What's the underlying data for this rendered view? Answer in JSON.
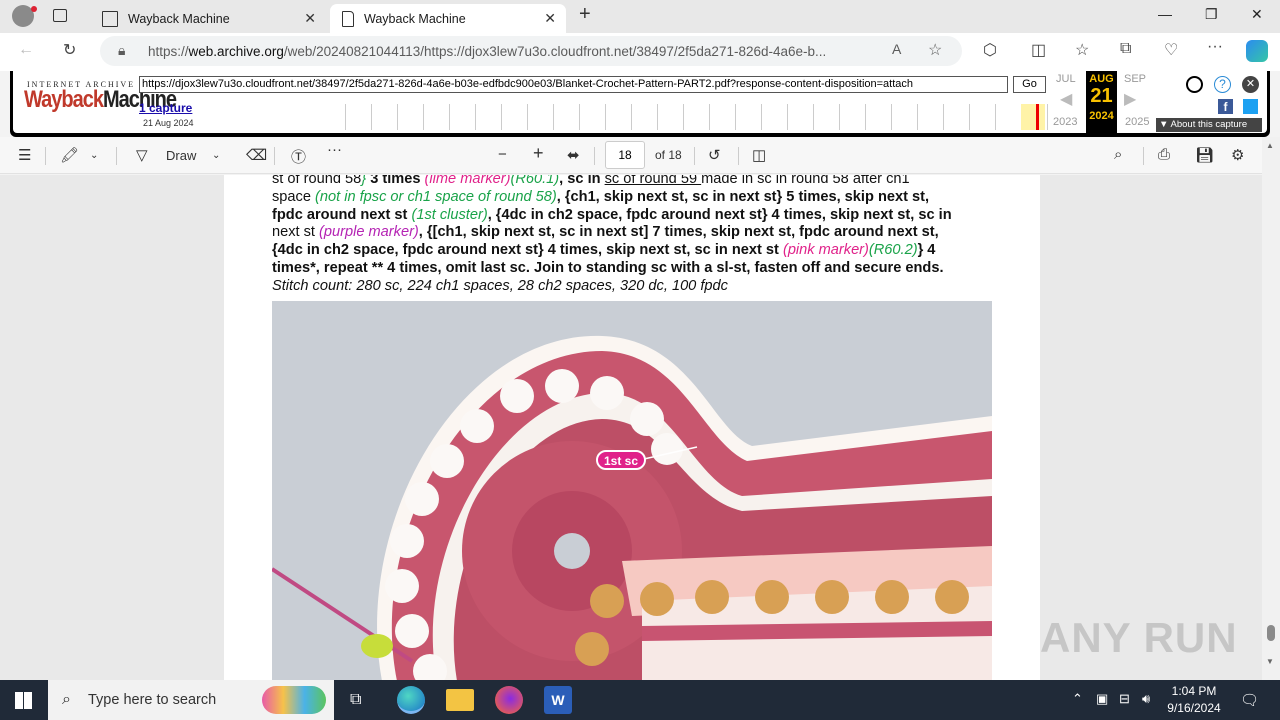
{
  "browser": {
    "tabs": [
      {
        "label": "Wayback Machine",
        "active": false
      },
      {
        "label": "Wayback Machine",
        "active": true
      }
    ],
    "url_prefix": "https://",
    "url_domain": "web.archive.org",
    "url_rest": "/web/20240821044113/https://djox3lew7u3o.cloudfront.net/38497/2f5da271-826d-4a6e-b..."
  },
  "wayback": {
    "logo_top": "INTERNET ARCHIVE",
    "logo_a": "Wayback",
    "logo_b": "Machine",
    "url": "https://djox3lew7u3o.cloudfront.net/38497/2f5da271-826d-4a6e-b03e-edfbdc900e03/Blanket-Crochet-Pattern-PART2.pdf?response-content-disposition=attach",
    "go": "Go",
    "captures": "1 capture",
    "capture_date": "21 Aug 2024",
    "prev_month": "JUL",
    "cur_month": "AUG",
    "cur_day": "21",
    "next_month": "SEP",
    "prev_year": "2023",
    "cur_year": "2024",
    "next_year": "2025",
    "about": "About this capture"
  },
  "pdf_toolbar": {
    "draw": "Draw",
    "page": "18",
    "of": "of 18"
  },
  "pdf": {
    "l1a": "st of round 58",
    "l1b": "3 times",
    "l1c": "(lime marker)",
    "l1d": "(R60.1)",
    "l1e": ", sc in ",
    "l1f": "sc of round 59 ",
    "l1g": "made in sc in round 58 after ch1",
    "l2a": "space ",
    "l2b": "(not in fpsc or ch1 space of round 58)",
    "l2c": ", {ch1, skip next st, sc in next st} 5 times, skip next st,",
    "l3a": "fpdc around next st ",
    "l3b": "(1st cluster)",
    "l3c": ", {4dc in ch2 space, fpdc around next st} 4 times, skip next st, sc in",
    "l4a": "next st ",
    "l4b": "(purple marker)",
    "l4c": ", {[ch1, skip next st, sc in next st] 7 times, skip next st, fpdc around next st,",
    "l5a": "{4dc in ch2 space, fpdc around next st} 4 times, skip next st, sc in next st ",
    "l5b": "(pink marker)",
    "l5c": "(R60.2)",
    "l5d": "} 4",
    "l6": "times*, repeat ** 4 times, omit last sc. Join to standing sc with a sl-st, fasten off and secure ends.",
    "l7": "Stitch count: 280 sc, 224 ch1 spaces, 28 ch2 spaces, 320 dc, 100 fpdc",
    "photo_label": "1st sc"
  },
  "taskbar": {
    "search": "Type here to search",
    "time": "1:04 PM",
    "date": "9/16/2024"
  },
  "watermark": "ANY RUN"
}
